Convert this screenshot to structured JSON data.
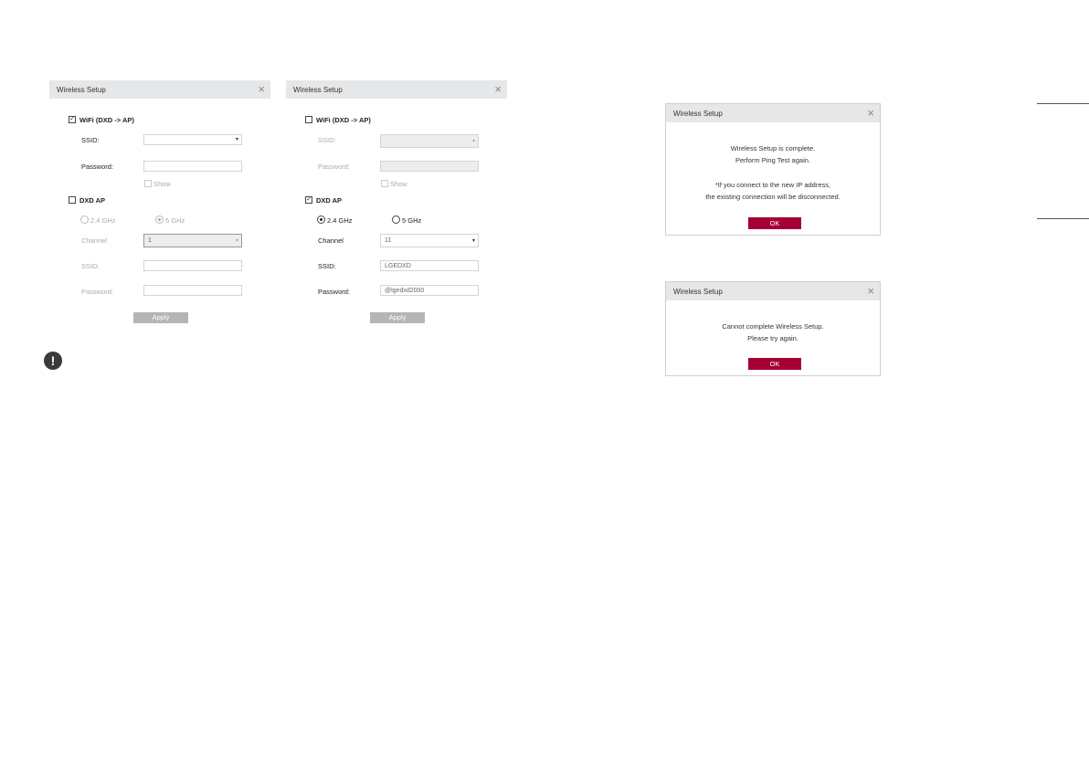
{
  "dialogs": {
    "left": {
      "title": "Wireless Setup",
      "wifi_label": "WiFi (DXD -> AP)",
      "wifi_checked": true,
      "ssid_label": "SSID:",
      "ssid_value": "",
      "password_label": "Password:",
      "password_value": "",
      "show_label": "Show",
      "dxd_ap_label": "DXD AP",
      "dxd_ap_checked": false,
      "band_24": "2.4 GHz",
      "band_5": "5 GHz",
      "band_selected": "5 GHz",
      "channel_label": "Channel",
      "channel_value": "1",
      "ap_ssid_label": "SSID:",
      "ap_ssid_value": "",
      "ap_password_label": "Password:",
      "ap_password_value": "",
      "apply_label": "Apply"
    },
    "middle": {
      "title": "Wireless Setup",
      "wifi_label": "WiFi (DXD -> AP)",
      "wifi_checked": false,
      "ssid_label": "SSID:",
      "ssid_value": "",
      "password_label": "Password:",
      "password_value": "",
      "show_label": "Show",
      "dxd_ap_label": "DXD AP",
      "dxd_ap_checked": true,
      "band_24": "2.4 GHz",
      "band_5": "5 GHz",
      "band_selected": "2.4 GHz",
      "channel_label": "Channel",
      "channel_value": "11",
      "ap_ssid_label": "SSID:",
      "ap_ssid_value": "LGEDXD",
      "ap_password_label": "Password:",
      "ap_password_value": "@lgedxd2000",
      "apply_label": "Apply"
    },
    "success": {
      "title": "Wireless Setup",
      "line1": "Wireless Setup is complete.",
      "line2": "Perform Ping Test again.",
      "line3": "*If you connect to the new IP address,",
      "line4": "the existing connection will be disconnected.",
      "ok_label": "OK"
    },
    "failure": {
      "title": "Wireless Setup",
      "line1": "Cannot complete Wireless Setup.",
      "line2": "Please try again.",
      "ok_label": "OK"
    }
  },
  "notice_icon": "exclamation-icon",
  "close_glyph": "×",
  "check_glyph": "✓",
  "dropdown_glyph": "▾",
  "notice_glyph": "!",
  "colors": {
    "accent_ok": "#a50034",
    "apply_button": "#b5b5b5",
    "titlebar": "#e6e7e8"
  }
}
